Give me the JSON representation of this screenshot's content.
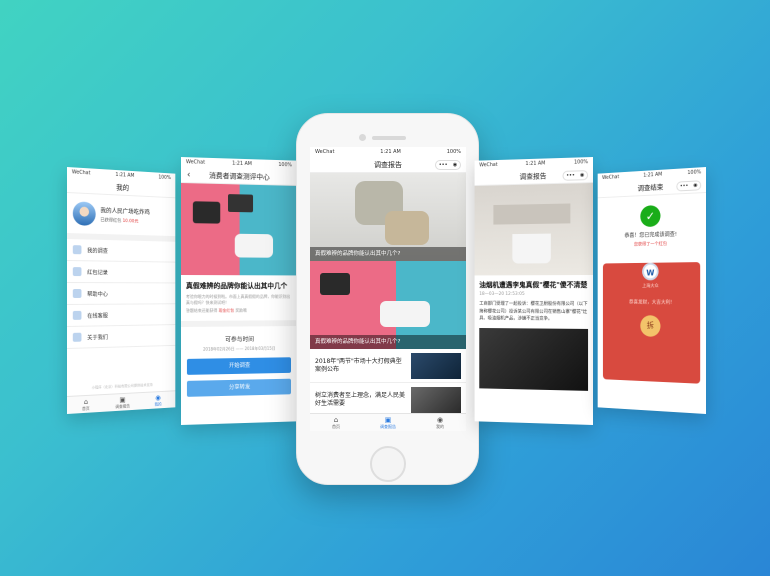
{
  "status": {
    "carrier": "WeChat",
    "time": "1:21 AM",
    "battery": "100%"
  },
  "profile_screen": {
    "title": "我的",
    "user_name": "我的人民广场吃炸鸡",
    "reward_prefix": "已获得红包",
    "reward_amount": "10.00元",
    "menu": [
      "我的调查",
      "红包记录",
      "帮助中心",
      "在线客服",
      "关于我们"
    ],
    "footer": "小程序（北京）科技有限公司提供技术支持",
    "tabs": [
      "首页",
      "调查报告",
      "我的"
    ]
  },
  "survey_screen": {
    "title": "消费者调查测评中心",
    "headline": "真假难辨的品牌你能认出其中几个",
    "desc": "考验你眼力的时候到啦。市面上真真假假的品牌，你能识别出真与假吗？快来测试吧！",
    "reward_prefix": "答题结束还能获得",
    "reward_amount": "现金红包",
    "reward_suffix": "奖励哦",
    "time_label": "可参与时间",
    "time_range": "2018年02月26日 —— 2018年03月15日",
    "btn_start": "开始调查",
    "btn_share": "分享转发"
  },
  "report_screen": {
    "title": "调查报告",
    "cards": [
      {
        "caption": "真假难辨的品牌你能认出其中几个?"
      },
      {
        "caption": "真假难辨的品牌你能认出其中几个?"
      }
    ],
    "rows": [
      {
        "title": "2018年\"两节\"市场十大打假典型案例公布"
      },
      {
        "title": "树立消费者至上理念，满足人民美好生活需要"
      }
    ],
    "tabs": [
      "首页",
      "调查报告",
      "我的"
    ]
  },
  "article_screen": {
    "title": "调查报告",
    "headline": "油烟机遭遇李鬼真假\"樱花\"傻不清楚",
    "meta": "18—03—20   12:53:05",
    "body": "工商部门受理了一起投诉：樱花卫厨股份有限公司（以下简称樱花公司）投诉某公司有限公司在销售山寨\"樱花\"灶具、吸油烟机产品，涉嫌不正当竞争。"
  },
  "finish_screen": {
    "title": "调查结束",
    "congrats": "恭喜！您已完成该调查!",
    "got": "您获得了一个红包",
    "brand": "上海大众",
    "wish": "恭喜发财，大吉大利!",
    "open": "拆"
  }
}
